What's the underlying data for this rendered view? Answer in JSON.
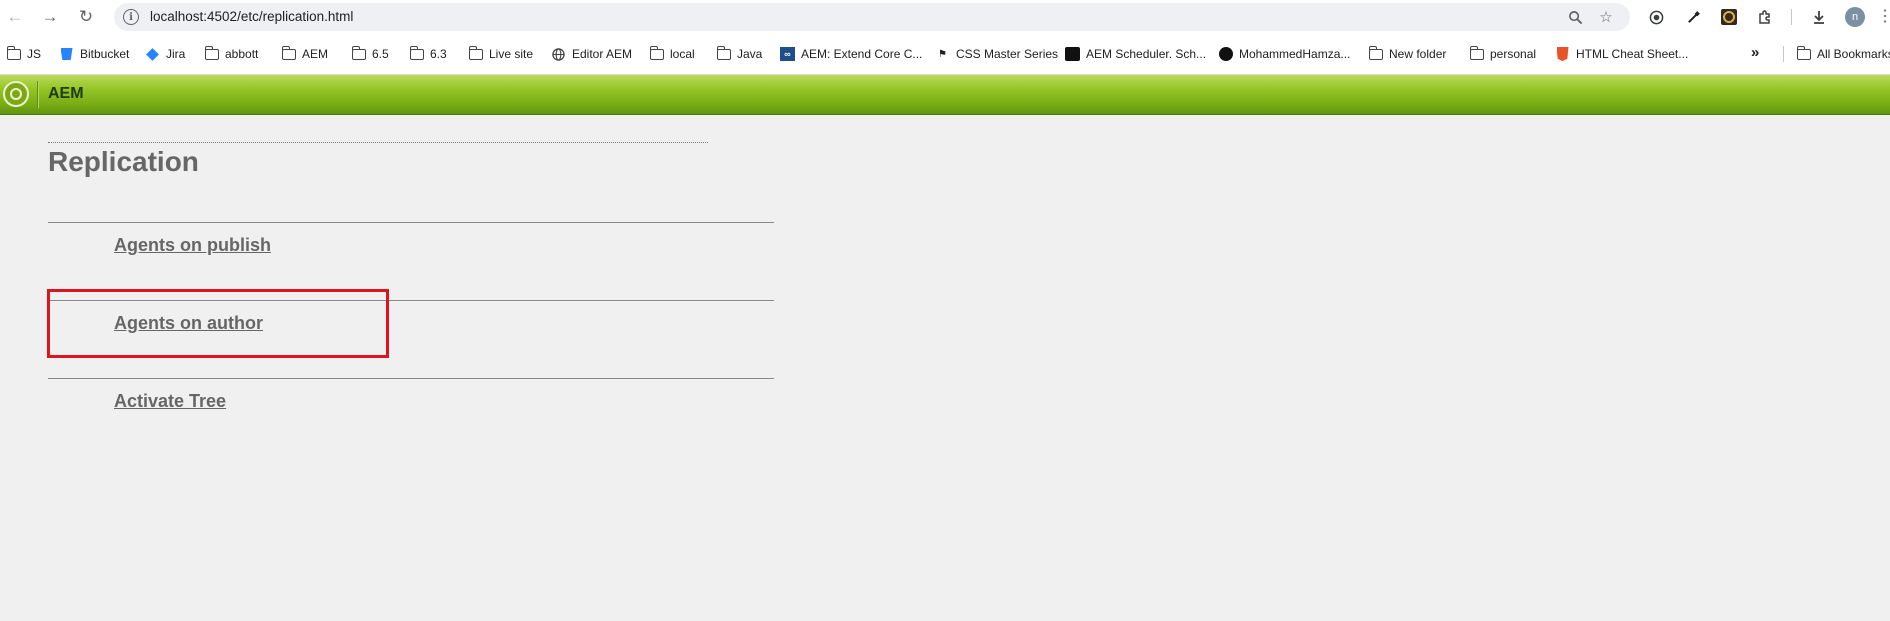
{
  "browser": {
    "url": "localhost:4502/etc/replication.html",
    "profile_initial": "n",
    "icons": {
      "back": "arrow-left-icon",
      "forward": "arrow-right-icon",
      "reload": "reload-icon",
      "site_info": "info-icon",
      "zoom": "zoom-icon",
      "bookmark": "star-icon",
      "download": "download-icon",
      "menu": "kebab-icon"
    }
  },
  "bookmarks": {
    "items": [
      {
        "label": "JS",
        "icon": "folder"
      },
      {
        "label": "Bitbucket",
        "icon": "bitbucket"
      },
      {
        "label": "Jira",
        "icon": "jira"
      },
      {
        "label": "abbott",
        "icon": "folder"
      },
      {
        "label": "AEM",
        "icon": "folder"
      },
      {
        "label": "6.5",
        "icon": "folder"
      },
      {
        "label": "6.3",
        "icon": "folder"
      },
      {
        "label": "Live site",
        "icon": "folder"
      },
      {
        "label": "Editor AEM",
        "icon": "globe"
      },
      {
        "label": "local",
        "icon": "folder"
      },
      {
        "label": "Java",
        "icon": "folder"
      },
      {
        "label": "AEM: Extend Core C...",
        "icon": "link"
      },
      {
        "label": "CSS Master Series",
        "icon": "flag"
      },
      {
        "label": "AEM Scheduler. Sch...",
        "icon": "video"
      },
      {
        "label": "MohammedHamza...",
        "icon": "github"
      },
      {
        "label": "New folder",
        "icon": "folder"
      },
      {
        "label": "personal",
        "icon": "folder"
      },
      {
        "label": "HTML Cheat Sheet...",
        "icon": "html"
      }
    ],
    "overflow": "»",
    "all_bookmarks": "All Bookmarks"
  },
  "aem": {
    "title": "AEM"
  },
  "page": {
    "title": "Replication",
    "links": [
      {
        "label": "Agents on publish"
      },
      {
        "label": "Agents on author",
        "highlighted": true
      },
      {
        "label": "Activate Tree"
      }
    ]
  },
  "colors": {
    "aem_bar": "#8cbf20",
    "highlight": "#e0141e",
    "link": "#666666"
  }
}
